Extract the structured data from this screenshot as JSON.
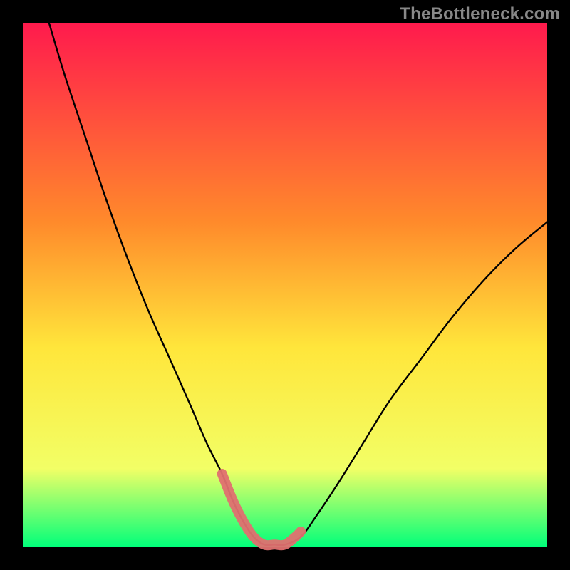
{
  "watermark": "TheBottleneck.com",
  "colors": {
    "background": "#000000",
    "gradient_top": "#ff1a4d",
    "gradient_mid1": "#ff8a2b",
    "gradient_mid2": "#ffe63b",
    "gradient_mid3": "#f2ff66",
    "gradient_bottom": "#00ff7a",
    "curve": "#000000",
    "highlight": "#e07070"
  },
  "chart_data": {
    "type": "line",
    "title": "",
    "xlabel": "",
    "ylabel": "",
    "xlim": [
      0,
      100
    ],
    "ylim": [
      0,
      100
    ],
    "series": [
      {
        "name": "bottleneck-curve",
        "x": [
          5,
          8,
          12,
          16,
          20,
          24,
          28,
          32,
          35,
          38,
          40,
          42,
          44,
          46,
          48,
          50,
          53,
          56,
          60,
          65,
          70,
          76,
          82,
          88,
          94,
          100
        ],
        "y": [
          100,
          90,
          78,
          66,
          55,
          45,
          36,
          27,
          20,
          14,
          9,
          5,
          2,
          0.5,
          0.5,
          0.5,
          2,
          6,
          12,
          20,
          28,
          36,
          44,
          51,
          57,
          62
        ]
      },
      {
        "name": "sweet-spot-highlight",
        "x": [
          38,
          40,
          42,
          44,
          46,
          48,
          50,
          52,
          53
        ],
        "y": [
          14,
          9,
          5,
          2,
          0.5,
          0.5,
          0.5,
          2,
          3
        ]
      }
    ],
    "annotations": []
  }
}
